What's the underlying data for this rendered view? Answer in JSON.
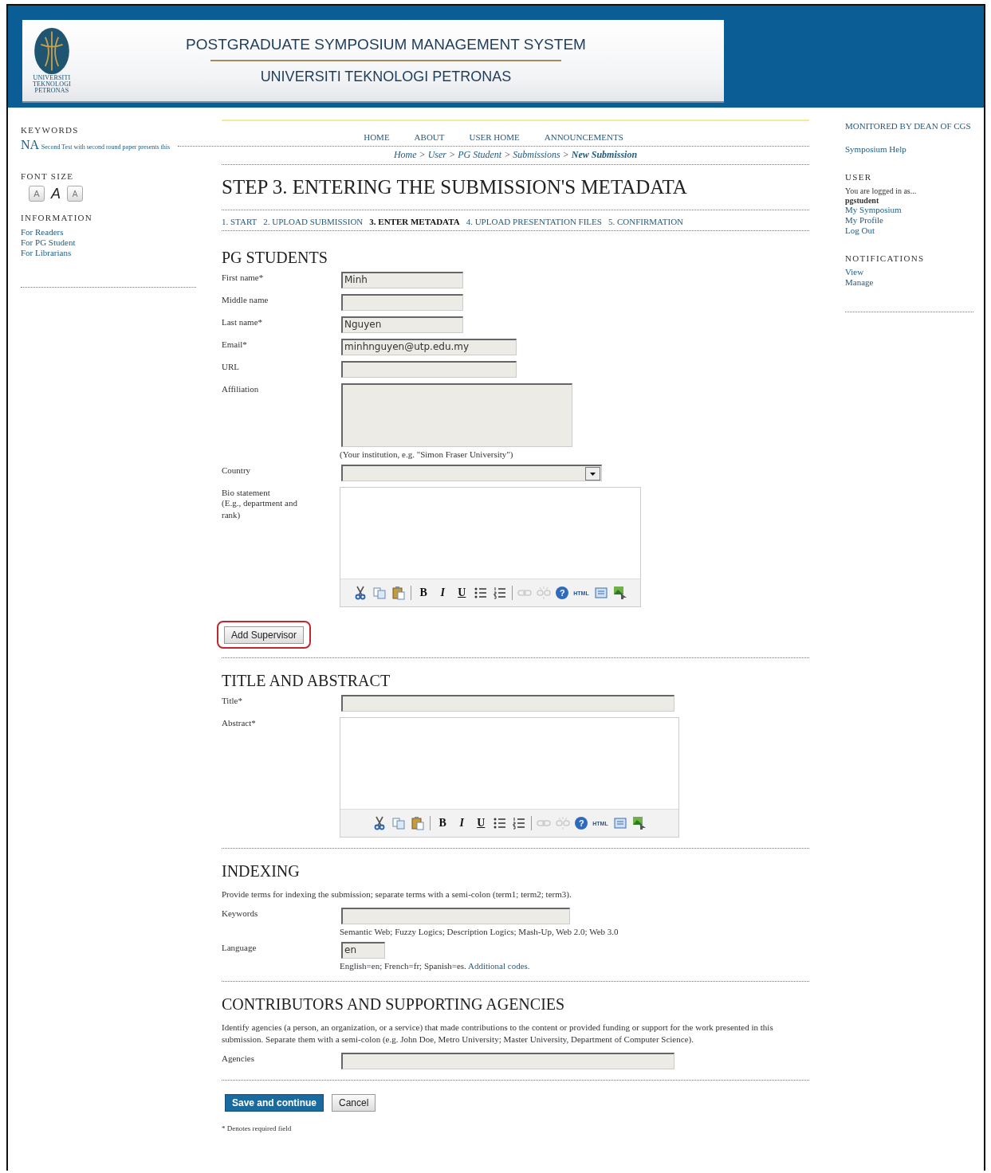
{
  "header": {
    "logo_text": [
      "UNIVERSITI",
      "TEKNOLOGI",
      "PETRONAS"
    ],
    "title": "POSTGRADUATE SYMPOSIUM MANAGEMENT SYSTEM",
    "subtitle": "UNIVERSITI TEKNOLOGI PETRONAS"
  },
  "left_sidebar": {
    "keywords_heading": "KEYWORDS",
    "keywords": [
      {
        "text": "NA",
        "kind": "large"
      },
      {
        "text": "Second Test with second round paper presents this",
        "kind": "small"
      }
    ],
    "font_size_heading": "FONT SIZE",
    "font_size_buttons": [
      {
        "kind": "smaller",
        "label": "A"
      },
      {
        "kind": "default",
        "label": "A"
      },
      {
        "kind": "larger",
        "label": "A"
      }
    ],
    "information_heading": "INFORMATION",
    "information_links": [
      "For Readers",
      "For PG Student",
      "For Librarians"
    ]
  },
  "nav": [
    "HOME",
    "ABOUT",
    "USER HOME",
    "ANNOUNCEMENTS"
  ],
  "breadcrumb": [
    {
      "kind": "link",
      "label": "Home",
      "current": false
    },
    {
      "kind": "sep",
      "label": ">"
    },
    {
      "kind": "link",
      "label": "User",
      "current": false
    },
    {
      "kind": "sep",
      "label": ">"
    },
    {
      "kind": "link",
      "label": "PG Student",
      "current": false
    },
    {
      "kind": "sep",
      "label": ">"
    },
    {
      "kind": "link",
      "label": "Submissions",
      "current": false
    },
    {
      "kind": "sep",
      "label": ">"
    },
    {
      "kind": "link",
      "label": "New Submission",
      "current": true
    }
  ],
  "page_title": "STEP 3. ENTERING THE SUBMISSION'S METADATA",
  "steps": [
    {
      "label": "1. START",
      "selected": false
    },
    {
      "label": "2. UPLOAD SUBMISSION",
      "selected": false
    },
    {
      "label": "3. ENTER METADATA",
      "selected": true
    },
    {
      "label": "4. UPLOAD PRESENTATION FILES",
      "selected": false
    },
    {
      "label": "5. CONFIRMATION",
      "selected": false
    }
  ],
  "sections": [
    {
      "title": "PG STUDENTS",
      "items": [
        {
          "kind": "text",
          "label": "First name*",
          "value": "Minh"
        },
        {
          "kind": "text",
          "label": "Middle name"
        },
        {
          "kind": "text",
          "label": "Last name*",
          "value": "Nguyen"
        },
        {
          "kind": "text",
          "label": "Email*",
          "value": "minhnguyen@utp.edu.my"
        },
        {
          "kind": "text",
          "label": "URL"
        },
        {
          "kind": "textarea",
          "label": "Affiliation",
          "hint": "(Your institution, e.g. \"Simon Fraser University\")"
        },
        {
          "kind": "select",
          "label": "Country"
        },
        {
          "kind": "editor",
          "label": "Bio statement",
          "label_note": "(E.g., department and rank)",
          "toolbar": [
            {
              "kind": "cut"
            },
            {
              "kind": "copy"
            },
            {
              "kind": "paste"
            },
            {
              "kind": "sep"
            },
            {
              "kind": "bold",
              "label": "B"
            },
            {
              "kind": "italic",
              "label": "I"
            },
            {
              "kind": "underline",
              "label": "U"
            },
            {
              "kind": "bullets"
            },
            {
              "kind": "numbers"
            },
            {
              "kind": "sep"
            },
            {
              "kind": "link"
            },
            {
              "kind": "unlink"
            },
            {
              "kind": "help",
              "label": "?"
            },
            {
              "kind": "html",
              "label": "HTML"
            },
            {
              "kind": "fullscreen"
            },
            {
              "kind": "image"
            }
          ]
        },
        {
          "kind": "button",
          "label": "Add Supervisor",
          "highlighted": true
        }
      ]
    },
    {
      "title": "TITLE AND ABSTRACT",
      "items": [
        {
          "kind": "text",
          "label": "Title*"
        },
        {
          "kind": "editor",
          "label": "Abstract*",
          "toolbar": [
            {
              "kind": "cut"
            },
            {
              "kind": "copy"
            },
            {
              "kind": "paste"
            },
            {
              "kind": "sep"
            },
            {
              "kind": "bold",
              "label": "B"
            },
            {
              "kind": "italic",
              "label": "I"
            },
            {
              "kind": "underline",
              "label": "U"
            },
            {
              "kind": "bullets"
            },
            {
              "kind": "numbers"
            },
            {
              "kind": "sep"
            },
            {
              "kind": "link"
            },
            {
              "kind": "unlink"
            },
            {
              "kind": "help",
              "label": "?"
            },
            {
              "kind": "html",
              "label": "HTML"
            },
            {
              "kind": "fullscreen"
            },
            {
              "kind": "image"
            }
          ]
        }
      ]
    },
    {
      "title": "INDEXING",
      "items": [
        {
          "kind": "paragraph",
          "text": "Provide terms for indexing the submission; separate terms with a semi-colon (term1; term2; term3)."
        },
        {
          "kind": "text",
          "label": "Keywords",
          "hint": "Semantic Web; Fuzzy Logics; Description Logics; Mash-Up, Web 2.0; Web 3.0"
        },
        {
          "kind": "text",
          "label": "Language",
          "value": "en",
          "hint": "English=en; French=fr; Spanish=es.",
          "hint_link": "Additional codes."
        }
      ]
    },
    {
      "title": "CONTRIBUTORS AND SUPPORTING AGENCIES",
      "items": [
        {
          "kind": "paragraph",
          "text": "Identify agencies (a person, an organization, or a service) that made contributions to the content or provided funding or support for the work presented in this submission. Separate them with a semi-colon (e.g. John Doe, Metro University; Master University, Department of Computer Science)."
        },
        {
          "kind": "text",
          "label": "Agencies"
        }
      ]
    }
  ],
  "actions": [
    {
      "kind": "primary",
      "label": "Save and continue"
    },
    {
      "kind": "secondary",
      "label": "Cancel"
    }
  ],
  "footnote": "* Denotes required field",
  "right_sidebar": {
    "monitored": "MONITORED BY DEAN OF CGS",
    "help_link": "Symposium Help",
    "user_heading": "USER",
    "logged_in_text": "You are logged in as...",
    "username": "pgstudent",
    "user_links": [
      "My Symposium",
      "My Profile",
      "Log Out"
    ],
    "notifications_heading": "NOTIFICATIONS",
    "notification_links": [
      "View",
      "Manage"
    ]
  }
}
